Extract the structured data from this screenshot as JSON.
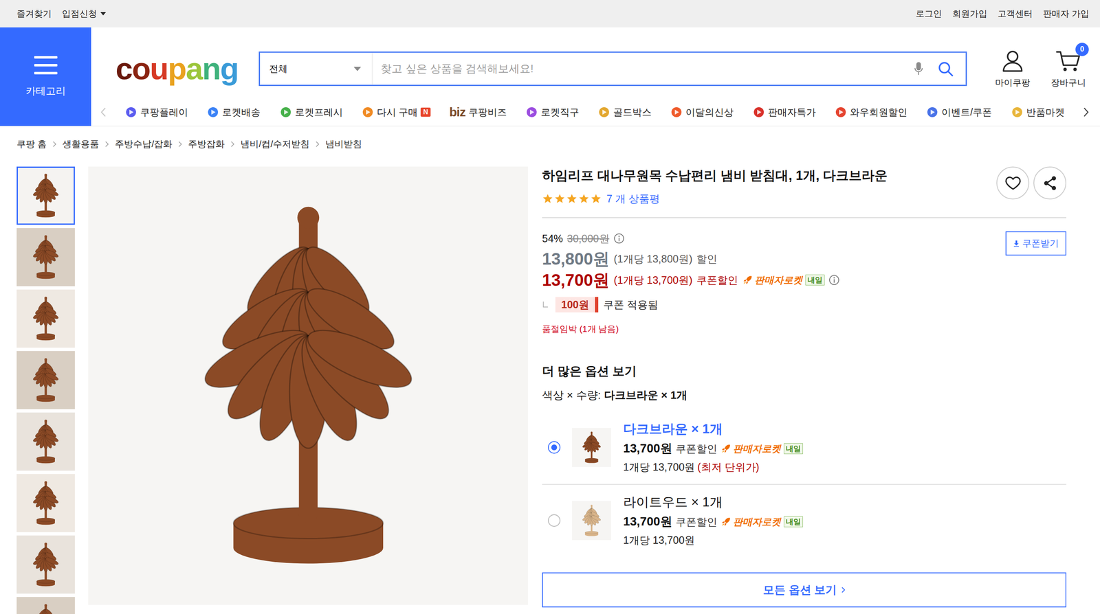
{
  "topbar": {
    "left": [
      {
        "label": "즐겨찾기",
        "dropdown": false
      },
      {
        "label": "입점신청",
        "dropdown": true
      }
    ],
    "right": [
      "로그인",
      "회원가입",
      "고객센터",
      "판매자 가입"
    ]
  },
  "category": {
    "label": "카테고리"
  },
  "logo": [
    {
      "char": "c",
      "color": "#6b1a0e"
    },
    {
      "char": "o",
      "color": "#8a2412"
    },
    {
      "char": "u",
      "color": "#d63a26"
    },
    {
      "char": "p",
      "color": "#e9a21f"
    },
    {
      "char": "a",
      "color": "#9cc63c"
    },
    {
      "char": "n",
      "color": "#3fb27c"
    },
    {
      "char": "g",
      "color": "#3a9bd8"
    }
  ],
  "search": {
    "scope": "전체",
    "placeholder": "찾고 싶은 상품을 검색해보세요!"
  },
  "account": {
    "label": "마이쿠팡"
  },
  "cart": {
    "label": "장바구니",
    "count": "0"
  },
  "nav_arrows": {
    "prev_disabled": true,
    "next_disabled": false
  },
  "nav": [
    {
      "label": "쿠팡플레이",
      "color": "#5b5cf0"
    },
    {
      "label": "로켓배송",
      "color": "#3b82f6"
    },
    {
      "label": "로켓프레시",
      "color": "#47b14b"
    },
    {
      "label": "다시 구매",
      "color": "#f08a24",
      "badge": "N"
    },
    {
      "label": "쿠팡비즈",
      "prefix": "biz"
    },
    {
      "label": "로켓직구",
      "color": "#9b4de0"
    },
    {
      "label": "골드박스",
      "color": "#e3a72f"
    },
    {
      "label": "이달의신상",
      "color": "#ef5a2a"
    },
    {
      "label": "판매자특가",
      "color": "#d9322b"
    },
    {
      "label": "와우회원할인",
      "color": "#e5442f"
    },
    {
      "label": "이벤트/쿠폰",
      "color": "#4a73e8"
    },
    {
      "label": "반품마켓",
      "color": "#e8b53a"
    }
  ],
  "breadcrumb": [
    "쿠팡 홈",
    "생활용품",
    "주방수납/잡화",
    "주방잡화",
    "냄비/컵/수저받침",
    "냄비받침"
  ],
  "thumbnails": [
    {
      "selected": true
    },
    {
      "selected": false
    },
    {
      "selected": false
    },
    {
      "selected": false
    },
    {
      "selected": false
    },
    {
      "selected": false
    },
    {
      "selected": false
    },
    {
      "selected": false
    }
  ],
  "product": {
    "title": "하임리프 대나무원목 수납편리 냄비 받침대, 1개, 다크브라운",
    "stars": 5,
    "reviews": "7 개 상품평",
    "discount": "54%",
    "original_price": "30,000원",
    "coupon_button": "쿠폰받기",
    "sale_price": "13,800원",
    "sale_unit": "(1개당 13,800원)",
    "sale_label": "할인",
    "coupon_price": "13,700원",
    "coupon_unit": "(1개당 13,700원)",
    "coupon_label": "쿠폰할인",
    "rocket": "판매자로켓",
    "eta": "내일",
    "coupon_amount": "100원",
    "coupon_applied": "쿠폰 적용됨",
    "stock": "품절임박 (1개 남음)"
  },
  "options": {
    "heading": "더 많은 옵션 보기",
    "selection_label": "색상 × 수량:",
    "selection_value": "다크브라운 × 1개",
    "items": [
      {
        "name": "다크브라운 × 1개",
        "price": "13,700원",
        "coupon": "쿠폰할인",
        "rocket": "판매자로켓",
        "eta": "내일",
        "unit": "1개당 13,700원",
        "note": "(최저 단위가)",
        "selected": true,
        "color": "#8b4a26"
      },
      {
        "name": "라이트우드 × 1개",
        "price": "13,700원",
        "coupon": "쿠폰할인",
        "rocket": "판매자로켓",
        "eta": "내일",
        "unit": "1개당 13,700원",
        "selected": false,
        "color": "#d8b48a"
      }
    ],
    "all_button": "모든 옵션 보기"
  }
}
